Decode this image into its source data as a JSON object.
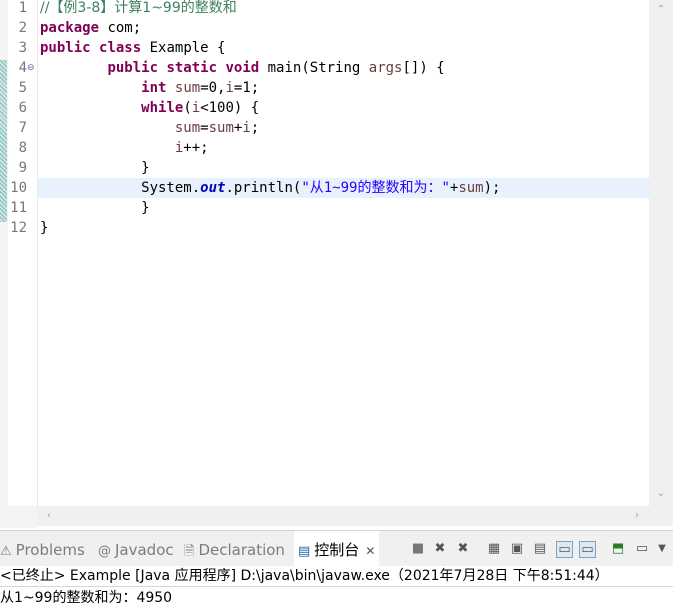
{
  "editor": {
    "line_numbers": [
      "1",
      "2",
      "3",
      "4",
      "5",
      "6",
      "7",
      "8",
      "9",
      "10",
      "11",
      "12"
    ],
    "lines": [
      [
        {
          "t": "//【例3-8】计算1~99的整数和",
          "c": "cm"
        }
      ],
      [
        {
          "t": "package",
          "c": "kw"
        },
        {
          "t": " com;",
          "c": ""
        }
      ],
      [
        {
          "t": "public",
          "c": "kw"
        },
        {
          "t": " ",
          "c": ""
        },
        {
          "t": "class",
          "c": "kw"
        },
        {
          "t": " Example {",
          "c": ""
        }
      ],
      [
        {
          "t": "        ",
          "c": ""
        },
        {
          "t": "public",
          "c": "kw"
        },
        {
          "t": " ",
          "c": ""
        },
        {
          "t": "static",
          "c": "kw"
        },
        {
          "t": " ",
          "c": ""
        },
        {
          "t": "void",
          "c": "kw"
        },
        {
          "t": " main(String ",
          "c": ""
        },
        {
          "t": "args",
          "c": "vr"
        },
        {
          "t": "[]) {",
          "c": ""
        }
      ],
      [
        {
          "t": "            ",
          "c": ""
        },
        {
          "t": "int",
          "c": "kw"
        },
        {
          "t": " ",
          "c": ""
        },
        {
          "t": "sum",
          "c": "vr"
        },
        {
          "t": "=0,",
          "c": ""
        },
        {
          "t": "i",
          "c": "vr"
        },
        {
          "t": "=1;",
          "c": ""
        }
      ],
      [
        {
          "t": "            ",
          "c": ""
        },
        {
          "t": "while",
          "c": "kw"
        },
        {
          "t": "(",
          "c": ""
        },
        {
          "t": "i",
          "c": "vr"
        },
        {
          "t": "<100) {",
          "c": ""
        }
      ],
      [
        {
          "t": "                ",
          "c": ""
        },
        {
          "t": "sum",
          "c": "vr"
        },
        {
          "t": "=",
          "c": ""
        },
        {
          "t": "sum",
          "c": "vr"
        },
        {
          "t": "+",
          "c": ""
        },
        {
          "t": "i",
          "c": "vr"
        },
        {
          "t": ";",
          "c": ""
        }
      ],
      [
        {
          "t": "                ",
          "c": ""
        },
        {
          "t": "i",
          "c": "vr"
        },
        {
          "t": "++;",
          "c": ""
        }
      ],
      [
        {
          "t": "            }",
          "c": ""
        }
      ],
      [
        {
          "t": "            System.",
          "c": ""
        },
        {
          "t": "out",
          "c": "fld"
        },
        {
          "t": ".println(",
          "c": ""
        },
        {
          "t": "\"从1~99的整数和为：\"",
          "c": "st"
        },
        {
          "t": "+",
          "c": ""
        },
        {
          "t": "sum",
          "c": "vr"
        },
        {
          "t": ");",
          "c": ""
        }
      ],
      [
        {
          "t": "            }",
          "c": ""
        }
      ],
      [
        {
          "t": "}",
          "c": ""
        }
      ]
    ],
    "fold_marker_line": 4,
    "current_line": 10
  },
  "views": {
    "tabs": [
      {
        "name": "problems",
        "label": "Problems",
        "icon": "problems-icon",
        "glyph": "⚠"
      },
      {
        "name": "javadoc",
        "label": "Javadoc",
        "icon": "javadoc-icon",
        "glyph": "@"
      },
      {
        "name": "declaration",
        "label": "Declaration",
        "icon": "declaration-icon",
        "glyph": "🗎"
      },
      {
        "name": "console",
        "label": "控制台",
        "icon": "console-icon",
        "glyph": "▤",
        "active": true
      }
    ],
    "close_glyph": "✕"
  },
  "console": {
    "header": "<已终止> Example [Java 应用程序] D:\\java\\bin\\javaw.exe（2021年7月28日 下午8:51:44）",
    "output": "从1~99的整数和为：4950"
  },
  "colors": {
    "keyword": "#7f0055",
    "comment": "#3f7f5f",
    "string": "#2a00ff",
    "field": "#0000c0",
    "variable": "#6a3e3e",
    "current_line": "#e8f2fe"
  }
}
